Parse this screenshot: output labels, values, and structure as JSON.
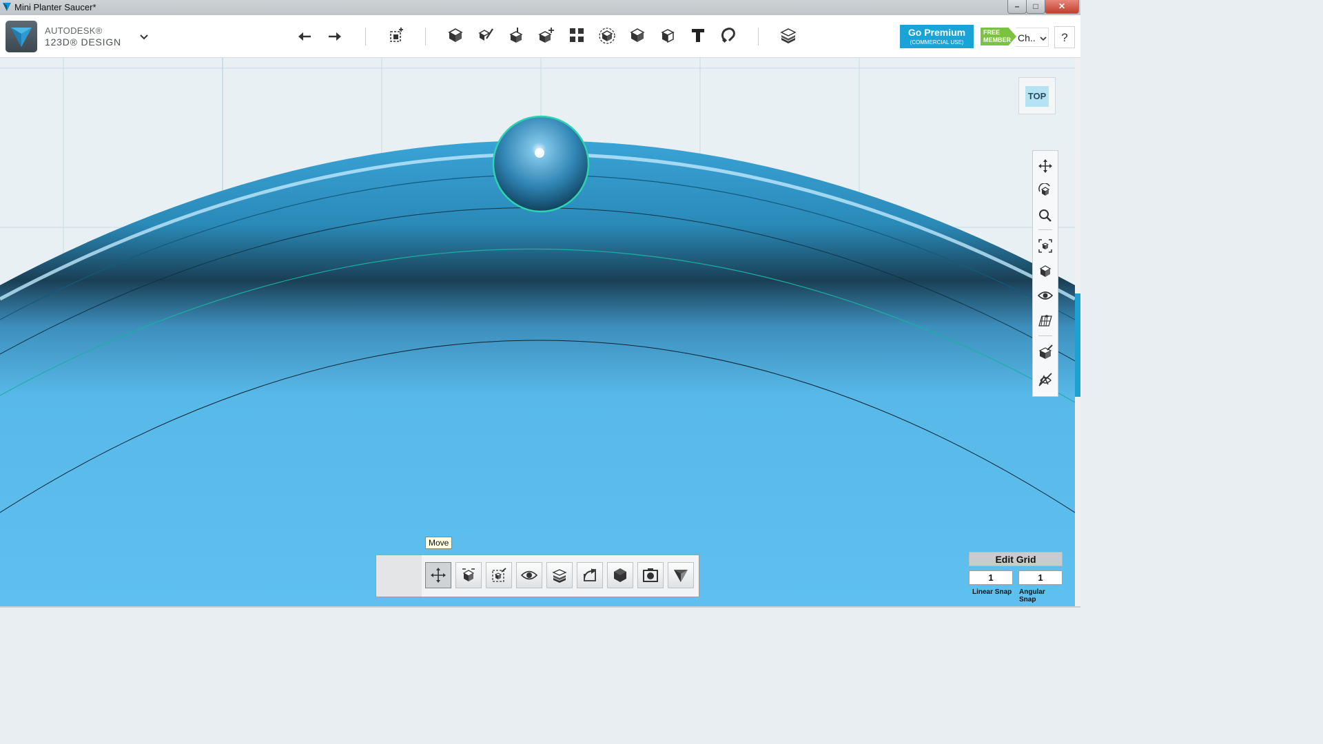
{
  "window": {
    "title": "Mini Planter Saucer*",
    "controls": [
      "–",
      "□",
      "✕"
    ]
  },
  "brand": {
    "line1": "AUTODESK®",
    "line2": "123D® DESIGN"
  },
  "toolbar": {
    "icons": [
      "undo-icon",
      "redo-icon",
      "transform-icon",
      "primitives-icon",
      "sketch-icon",
      "construct-icon",
      "modify-icon",
      "pattern-icon",
      "group-icon",
      "combine-icon",
      "measure-icon",
      "text-icon",
      "snap-icon",
      "material-icon"
    ]
  },
  "account": {
    "premium_title": "Go Premium",
    "premium_sub": "(COMMERCIAL USE)",
    "badge_line1": "FREE",
    "badge_line2": "MEMBER",
    "user": "Ch..",
    "help": "?"
  },
  "viewcube": {
    "face": "TOP"
  },
  "tooltip": {
    "text": "Move"
  },
  "grid": {
    "edit_label": "Edit Grid",
    "linear_value": "1",
    "angular_value": "1",
    "linear_label": "Linear Snap",
    "angular_label": "Angular Snap"
  },
  "colors": {
    "accent": "#1aa3d6",
    "model": "#5bbdea",
    "premium": "#1aa3d6",
    "free_badge": "#7cc242"
  }
}
